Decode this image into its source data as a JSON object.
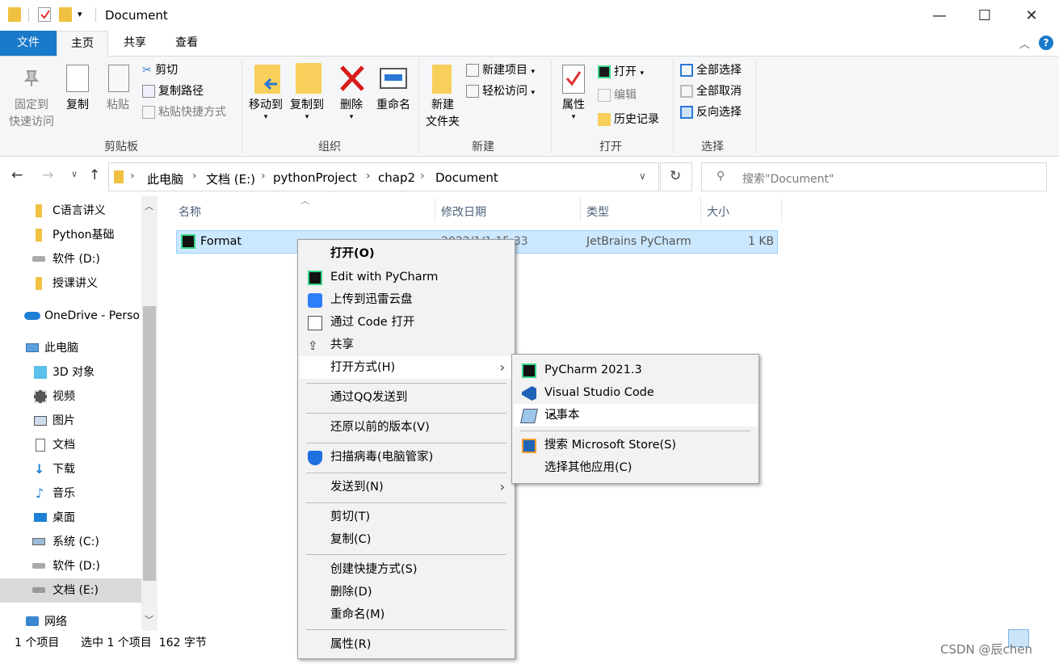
{
  "window": {
    "title": "Document",
    "minimize": "—",
    "maximize": "☐",
    "close": "✕"
  },
  "ribbon_tabs": {
    "file": "文件",
    "home": "主页",
    "share": "共享",
    "view": "查看"
  },
  "ribbon": {
    "pin_line1": "固定到",
    "pin_line2": "快速访问",
    "copy": "复制",
    "paste": "粘贴",
    "cut": "剪切",
    "copy_path": "复制路径",
    "paste_shortcut": "粘贴快捷方式",
    "group_clipboard": "剪贴板",
    "move_to": "移动到",
    "copy_to": "复制到",
    "delete": "删除",
    "rename": "重命名",
    "group_organize": "组织",
    "new_folder_line1": "新建",
    "new_folder_line2": "文件夹",
    "new_item": "新建项目",
    "easy_access": "轻松访问",
    "group_new": "新建",
    "properties": "属性",
    "open": "打开",
    "edit": "编辑",
    "history": "历史记录",
    "group_open": "打开",
    "select_all": "全部选择",
    "select_none": "全部取消",
    "invert_selection": "反向选择",
    "group_select": "选择"
  },
  "address": {
    "crumbs": [
      "此电脑",
      "文档 (E:)",
      "pythonProject",
      "chap2",
      "Document"
    ],
    "search_placeholder": "搜索\"Document\""
  },
  "nav": {
    "items": [
      {
        "label": "C语言讲义",
        "icon": "folder-icon"
      },
      {
        "label": "Python基础",
        "icon": "folder-icon"
      },
      {
        "label": "软件 (D:)",
        "icon": "drive-icon"
      },
      {
        "label": "授课讲义",
        "icon": "folder-icon"
      },
      {
        "label": "OneDrive - Perso",
        "icon": "onedrive-icon"
      },
      {
        "label": "此电脑",
        "icon": "computer-icon"
      },
      {
        "label": "3D 对象",
        "icon": "cube-icon"
      },
      {
        "label": "视频",
        "icon": "video-icon"
      },
      {
        "label": "图片",
        "icon": "picture-icon"
      },
      {
        "label": "文档",
        "icon": "document-icon"
      },
      {
        "label": "下载",
        "icon": "download-icon"
      },
      {
        "label": "音乐",
        "icon": "music-icon"
      },
      {
        "label": "桌面",
        "icon": "desktop-icon"
      },
      {
        "label": "系统 (C:)",
        "icon": "system-drive-icon"
      },
      {
        "label": "软件 (D:)",
        "icon": "drive-icon"
      },
      {
        "label": "文档 (E:)",
        "icon": "drive-icon"
      },
      {
        "label": "网络",
        "icon": "network-icon"
      }
    ]
  },
  "columns": {
    "name": "名称",
    "modified": "修改日期",
    "type": "类型",
    "size": "大小"
  },
  "file": {
    "name": "Format",
    "modified": "2022/1/1 15:33",
    "type": "JetBrains PyCharm",
    "size": "1 KB"
  },
  "status": {
    "count": "1 个项目",
    "selected": "选中 1 个项目  162 字节"
  },
  "context_menu": {
    "open": "打开(O)",
    "edit_pycharm": "Edit with PyCharm",
    "upload_xunlei": "上传到迅雷云盘",
    "open_code": "通过 Code 打开",
    "share": "共享",
    "open_with": "打开方式(H)",
    "send_qq": "通过QQ发送到",
    "restore": "还原以前的版本(V)",
    "scan": "扫描病毒(电脑管家)",
    "send_to": "发送到(N)",
    "cut": "剪切(T)",
    "copy": "复制(C)",
    "create_shortcut": "创建快捷方式(S)",
    "delete": "删除(D)",
    "rename": "重命名(M)",
    "properties": "属性(R)"
  },
  "submenu": {
    "pycharm": "PyCharm 2021.3",
    "vscode": "Visual Studio Code",
    "notepad": "记事本",
    "store": "搜索 Microsoft Store(S)",
    "other": "选择其他应用(C)"
  },
  "watermark": "CSDN @辰chen"
}
